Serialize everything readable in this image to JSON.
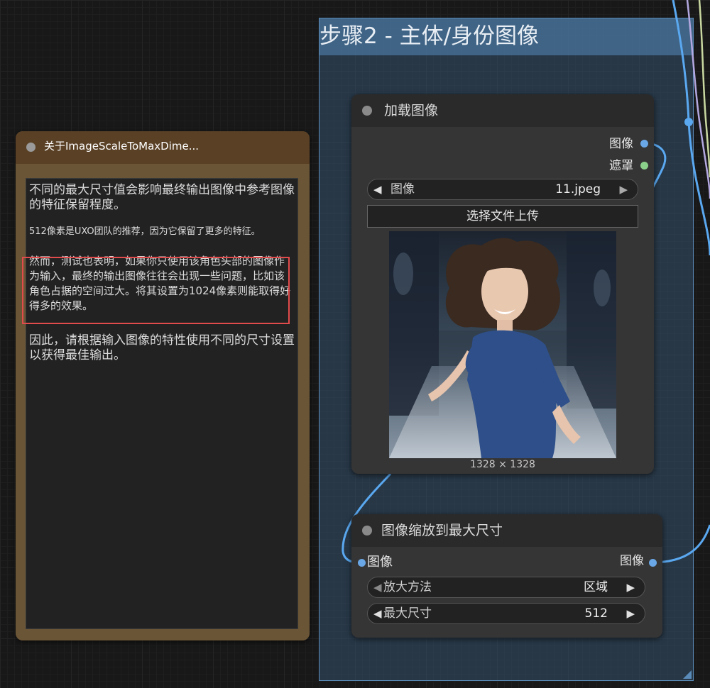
{
  "group": {
    "title": "步骤2 - 主体/身份图像"
  },
  "note_node": {
    "title": "关于ImageScaleToMaxDime...",
    "paragraphs": [
      "不同的最大尺寸值会影响最终输出图像中参考图像的特征保留程度。",
      "512像素是UXO团队的推荐，因为它保留了更多的特征。",
      "然而，测试也表明，如果你只使用该角色头部的图像作为输入，最终的输出图像往往会出现一些问题，比如该角色占据的空间过大。将其设置为1024像素则能取得好得多的效果。",
      "因此，请根据输入图像的特性使用不同的尺寸设置以获得最佳输出。"
    ]
  },
  "load_image_node": {
    "title": "加载图像",
    "outputs": [
      "图像",
      "遮罩"
    ],
    "image_widget": {
      "label": "图像",
      "value": "11.jpeg"
    },
    "upload_label": "选择文件上传",
    "preview_size": "1328 × 1328"
  },
  "scale_node": {
    "title": "图像缩放到最大尺寸",
    "input": "图像",
    "output": "图像",
    "widgets": [
      {
        "label": "放大方法",
        "value": "区域"
      },
      {
        "label": "最大尺寸",
        "value": "512"
      }
    ]
  },
  "colors": {
    "wire_image": "#5aa8f0",
    "wire_purple": "#b4a8e0",
    "wire_green": "#c8d8a0",
    "highlight": "#e24b4b"
  }
}
